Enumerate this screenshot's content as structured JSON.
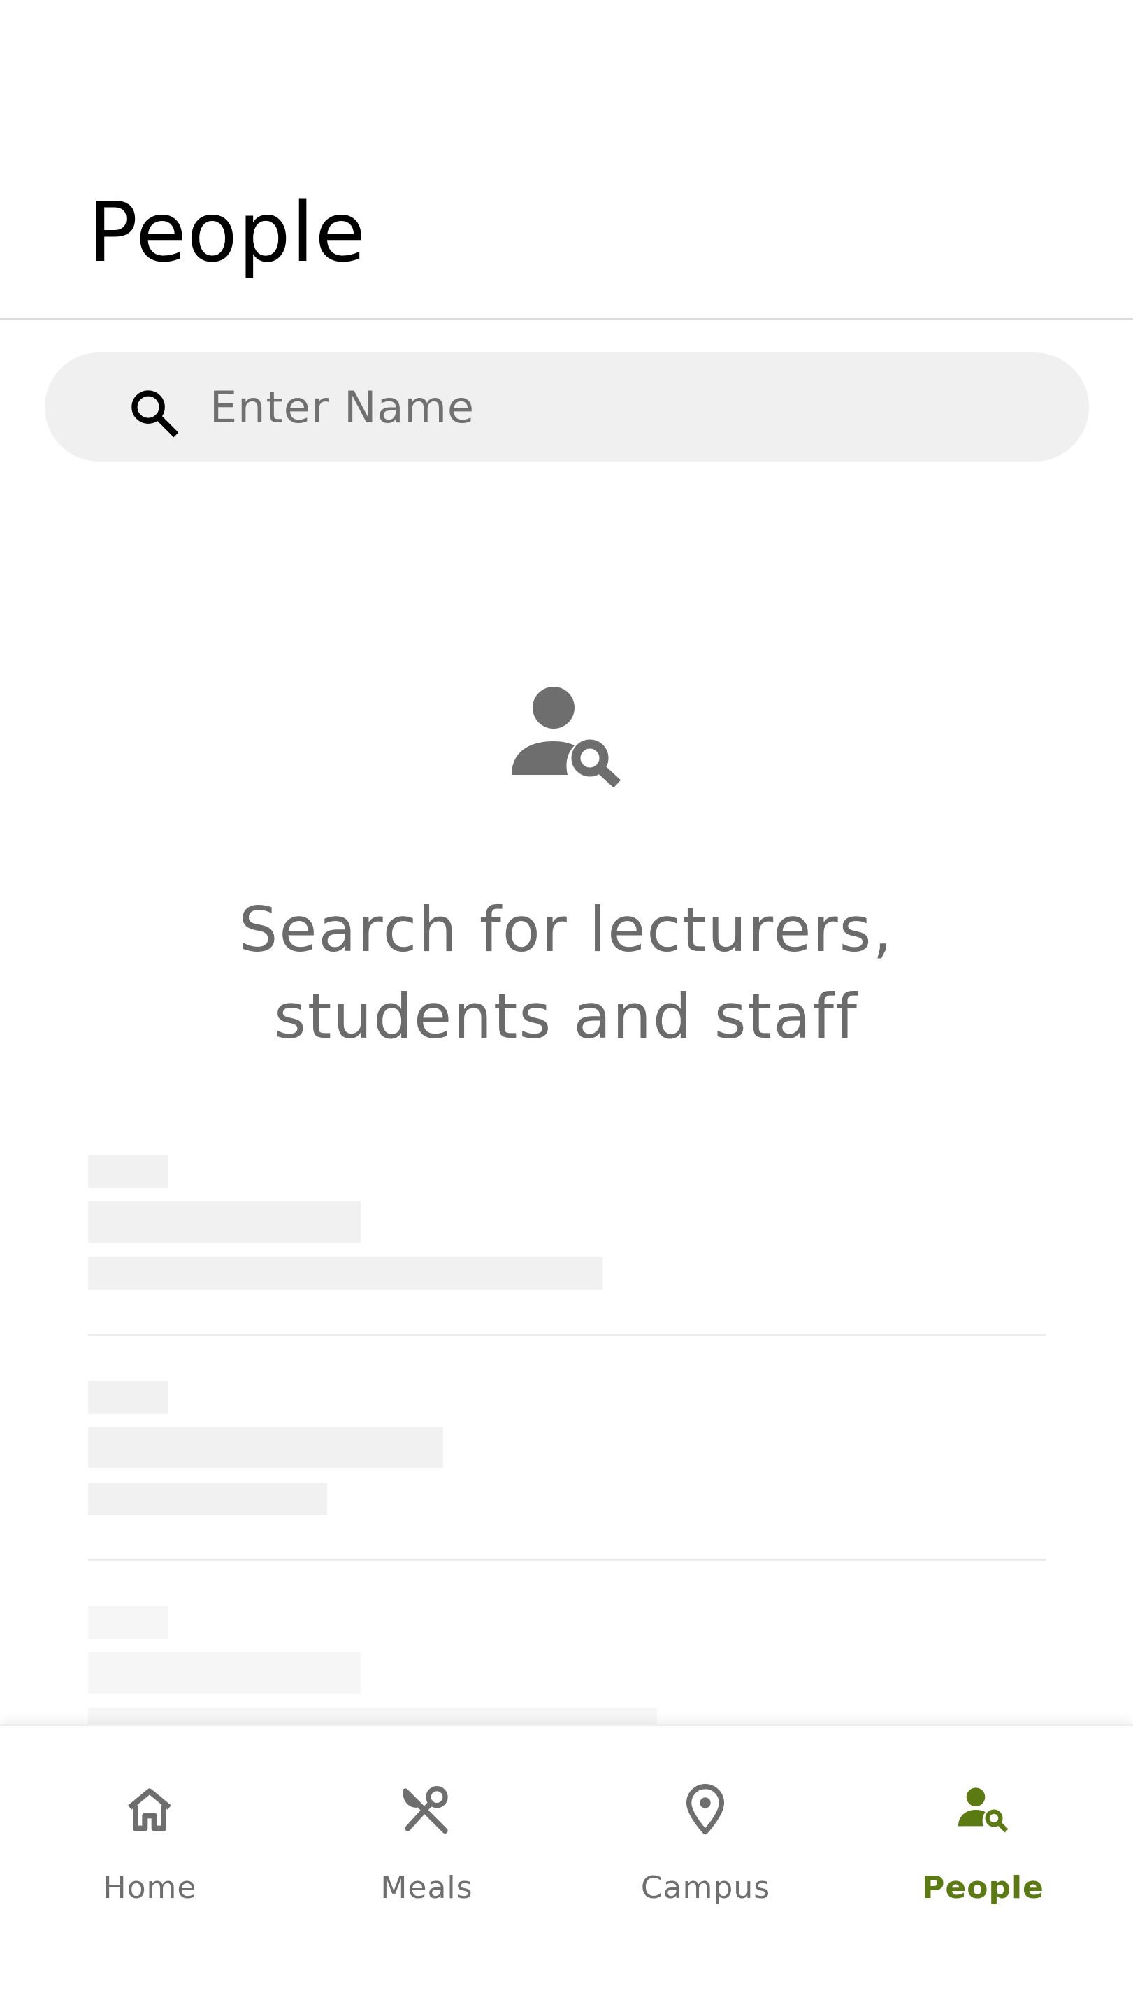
{
  "header": {
    "title": "People"
  },
  "search": {
    "placeholder": "Enter Name",
    "value": ""
  },
  "empty_state": {
    "icon": "person-search-icon",
    "line1": "Search for lecturers,",
    "line2": "students and staff"
  },
  "bottom_nav": {
    "items": [
      {
        "label": "Home",
        "icon": "home-icon",
        "active": false
      },
      {
        "label": "Meals",
        "icon": "fork-knife-icon",
        "active": false
      },
      {
        "label": "Campus",
        "icon": "location-pin-icon",
        "active": false
      },
      {
        "label": "People",
        "icon": "person-search-icon",
        "active": true
      }
    ]
  },
  "colors": {
    "accent": "#5b7a11",
    "icon_gray": "#6e6e6e",
    "search_bg": "#f0f0f0",
    "skeleton": "#f1f1f1"
  }
}
